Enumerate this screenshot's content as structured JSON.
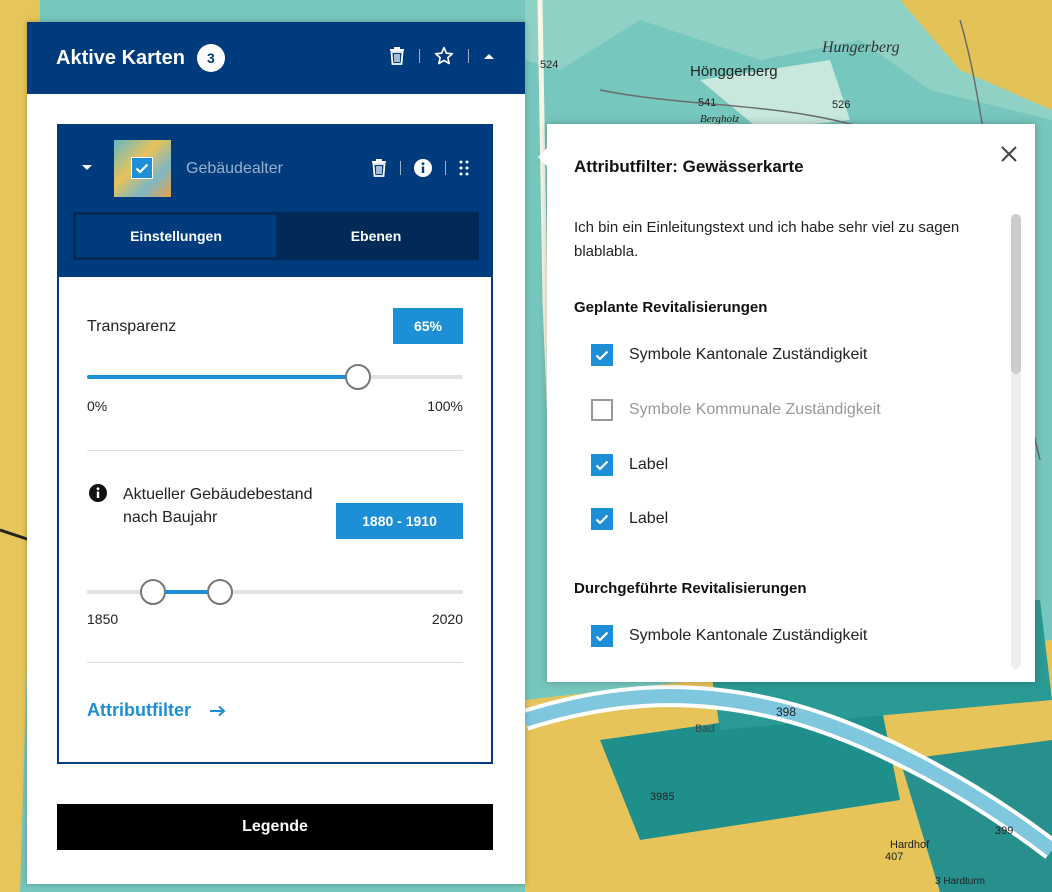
{
  "colors": {
    "header_blue": "#003c7d",
    "accent_blue": "#1c8fd6",
    "tabs_bg": "#012a58",
    "legend_bg": "#000000"
  },
  "map": {
    "labels": [
      "Hungerberg",
      "Hönggerberg",
      "524",
      "541",
      "526",
      "Bergholz",
      "398",
      "Bad",
      "3985",
      "407",
      "Hardhof",
      "399",
      "3 Hardturm"
    ]
  },
  "panel": {
    "title": "Aktive Karten",
    "count": "3",
    "icons": [
      "trash-icon",
      "star-icon",
      "caret-up-icon"
    ],
    "layer": {
      "name": "Gebäudealter",
      "icons": [
        "chevron-down-icon",
        "trash-icon",
        "info-icon",
        "drag-handle-icon"
      ],
      "tabs": [
        {
          "label": "Einstellungen",
          "active": true
        },
        {
          "label": "Ebenen",
          "active": false
        }
      ],
      "transparency": {
        "label": "Transparenz",
        "value_text": "65%",
        "value": 0.72,
        "min_label": "0%",
        "max_label": "100%"
      },
      "year_range": {
        "label": "Aktueller Gebäudebestand nach Baujahr",
        "value_text": "1880 - 1910",
        "min": 1850,
        "max": 2020,
        "start": 1880,
        "end": 1910,
        "min_label": "1850",
        "max_label": "2020"
      },
      "attribute_link": "Attributfilter"
    },
    "legend_button": "Legende"
  },
  "popover": {
    "title": "Attributfilter: Gewässerkarte",
    "intro": "Ich bin ein Einleitungstext und ich habe sehr viel zu sagen blablabla.",
    "groups": [
      {
        "title": "Geplante Revitalisierungen",
        "items": [
          {
            "label": "Symbole Kantonale Zuständigkeit",
            "checked": true,
            "disabled": false
          },
          {
            "label": "Symbole Kommunale Zuständigkeit",
            "checked": false,
            "disabled": true
          },
          {
            "label": "Label",
            "checked": true,
            "disabled": false
          },
          {
            "label": "Label",
            "checked": true,
            "disabled": false
          }
        ]
      },
      {
        "title": "Durchgeführte Revitalisierungen",
        "items": [
          {
            "label": "Symbole Kantonale Zuständigkeit",
            "checked": true,
            "disabled": false
          }
        ]
      }
    ]
  }
}
